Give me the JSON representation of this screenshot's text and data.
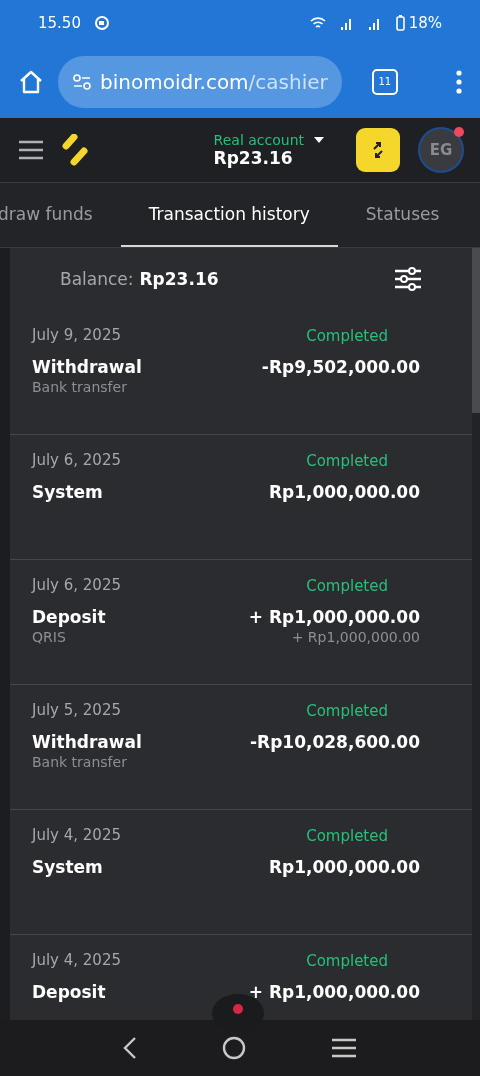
{
  "status_bar": {
    "time": "15.50",
    "battery": "18%"
  },
  "browser": {
    "url_host": "binomoidr.com",
    "url_path": "/cashier",
    "tab_count": "11"
  },
  "header": {
    "account_type": "Real account",
    "balance": "Rp23.16",
    "avatar_initials": "EG",
    "has_notification": true
  },
  "tabs": [
    {
      "label": "draw funds",
      "selected": false
    },
    {
      "label": "Transaction history",
      "selected": true
    },
    {
      "label": "Statuses",
      "selected": false
    }
  ],
  "balance": {
    "label": "Balance:",
    "value": "Rp23.16"
  },
  "transactions": [
    {
      "date": "July 9, 2025",
      "status": "Completed",
      "type": "Withdrawal",
      "method": "Bank transfer",
      "amount": "-Rp9,502,000.00"
    },
    {
      "date": "July 6, 2025",
      "status": "Completed",
      "type": "System",
      "amount": "Rp1,000,000.00"
    },
    {
      "date": "July 6, 2025",
      "status": "Completed",
      "type": "Deposit",
      "method": "QRIS",
      "amount": "+ Rp1,000,000.00",
      "sub_amount": "+ Rp1,000,000.00"
    },
    {
      "date": "July 5, 2025",
      "status": "Completed",
      "type": "Withdrawal",
      "method": "Bank transfer",
      "amount": "-Rp10,028,600.00"
    },
    {
      "date": "July 4, 2025",
      "status": "Completed",
      "type": "System",
      "amount": "Rp1,000,000.00"
    },
    {
      "date": "July 4, 2025",
      "status": "Completed",
      "type": "Deposit",
      "amount": "+ Rp1,000,000.00"
    }
  ]
}
